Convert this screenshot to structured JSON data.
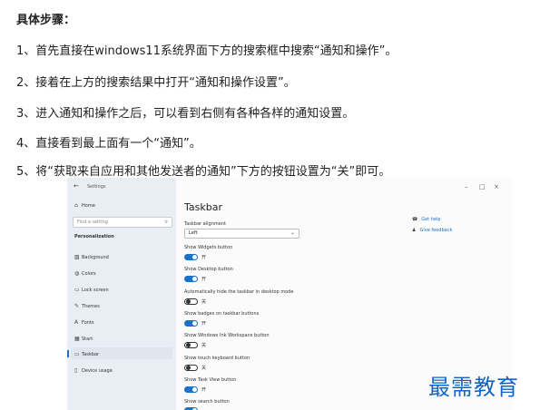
{
  "article": {
    "heading": "具体步骤：",
    "steps": [
      "1、首先直接在windows11系统界面下方的搜索框中搜索“通知和操作”。",
      "2、接着在上方的搜索结果中打开“通知和操作设置”。",
      "3、进入通知和操作之后，可以看到右侧有各种各样的通知设置。",
      "4、直接看到最上面有一个“通知”。",
      "5、将“获取来自应用和其他发送者的通知”下方的按钮设置为“关”即可。"
    ]
  },
  "settings": {
    "window_title": "Settings",
    "back_glyph": "←",
    "controls": {
      "minimize": "–",
      "maximize": "□",
      "close": "×"
    },
    "sidebar": {
      "home": "Home",
      "search_placeholder": "Find a setting",
      "section": "Personalization",
      "items": [
        {
          "label": "Background",
          "icon": "image-icon",
          "glyph": "▨"
        },
        {
          "label": "Colors",
          "icon": "palette-icon",
          "glyph": "◍"
        },
        {
          "label": "Lock screen",
          "icon": "lock-screen-icon",
          "glyph": "▭"
        },
        {
          "label": "Themes",
          "icon": "brush-icon",
          "glyph": "✎"
        },
        {
          "label": "Fonts",
          "icon": "fonts-icon",
          "glyph": "A"
        },
        {
          "label": "Start",
          "icon": "start-icon",
          "glyph": "▦"
        },
        {
          "label": "Taskbar",
          "icon": "taskbar-icon",
          "glyph": "▭"
        },
        {
          "label": "Device usage",
          "icon": "device-icon",
          "glyph": "▯"
        }
      ]
    },
    "main": {
      "title": "Taskbar",
      "alignment_label": "Taskbar alignment",
      "alignment_value": "Left",
      "toggles": [
        {
          "label": "Show Widgets button",
          "state": "开",
          "on": true
        },
        {
          "label": "Show Desktop button",
          "state": "开",
          "on": true
        },
        {
          "label": "Automatically hide the taskbar in desktop mode",
          "state": "关",
          "on": false
        },
        {
          "label": "Show badges on taskbar buttons",
          "state": "开",
          "on": true
        },
        {
          "label": "Show Windows Ink Workspace button",
          "state": "关",
          "on": false
        },
        {
          "label": "Show touch keyboard button",
          "state": "关",
          "on": false
        },
        {
          "label": "Show Task View button",
          "state": "开",
          "on": true
        },
        {
          "label": "Show search button",
          "state": "",
          "on": true
        }
      ],
      "links": [
        {
          "label": "Get help",
          "icon": "help-icon",
          "glyph": "☎"
        },
        {
          "label": "Give feedback",
          "icon": "feedback-icon",
          "glyph": "♟"
        }
      ]
    }
  },
  "watermark": "最需教育",
  "colors": {
    "accent": "#1a73c8",
    "watermark": "#1565c0",
    "sidebar_bg": "#e9eef4"
  }
}
